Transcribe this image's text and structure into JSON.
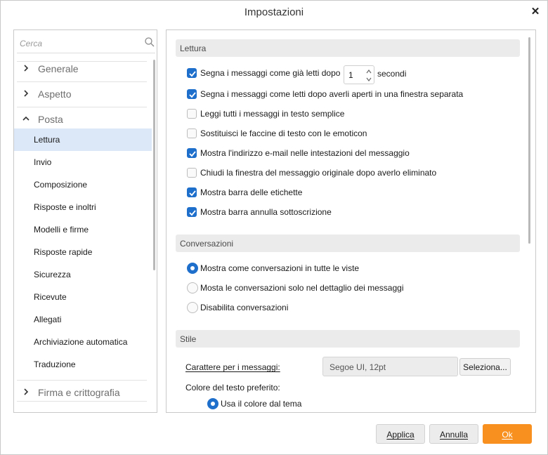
{
  "window": {
    "title": "Impostazioni"
  },
  "search": {
    "placeholder": "Cerca"
  },
  "nav": {
    "groups": [
      {
        "label": "Generale",
        "expanded": false
      },
      {
        "label": "Aspetto",
        "expanded": false
      },
      {
        "label": "Posta",
        "expanded": true
      },
      {
        "label": "Firma e crittografia",
        "expanded": false
      }
    ],
    "items": [
      {
        "label": "Lettura",
        "active": true
      },
      {
        "label": "Invio"
      },
      {
        "label": "Composizione"
      },
      {
        "label": "Risposte e inoltri"
      },
      {
        "label": "Modelli e firme"
      },
      {
        "label": "Risposte rapide"
      },
      {
        "label": "Sicurezza"
      },
      {
        "label": "Ricevute"
      },
      {
        "label": "Allegati"
      },
      {
        "label": "Archiviazione automatica"
      },
      {
        "label": "Traduzione"
      }
    ]
  },
  "lettura": {
    "header": "Lettura",
    "options": [
      {
        "label": "Segna i messaggi come già letti dopo",
        "checked": true
      },
      {
        "label": "Segna i messaggi come letti dopo averli aperti in una finestra separata",
        "checked": true
      },
      {
        "label": "Leggi tutti i messaggi in testo semplice",
        "checked": false
      },
      {
        "label": "Sostituisci le faccine di testo con le emoticon",
        "checked": false
      },
      {
        "label": "Mostra l'indirizzo e-mail nelle intestazioni del messaggio",
        "checked": true
      },
      {
        "label": "Chiudi la finestra del messaggio originale dopo averlo eliminato",
        "checked": false
      },
      {
        "label": "Mostra barra delle etichette",
        "checked": true
      },
      {
        "label": "Mostra barra annulla sottoscrizione",
        "checked": true
      }
    ],
    "delay_value": "1",
    "delay_unit": "secondi"
  },
  "conversazioni": {
    "header": "Conversazioni",
    "options": [
      {
        "label": "Mostra come conversazioni in tutte le viste",
        "selected": true
      },
      {
        "label": "Mosta le conversazioni solo nel dettaglio dei messaggi",
        "selected": false
      },
      {
        "label": "Disabilita conversazioni",
        "selected": false
      }
    ]
  },
  "stile": {
    "header": "Stile",
    "font_label": "Carattere per i messaggi:",
    "font_value": "Segoe UI, 12pt",
    "select_button": "Seleziona...",
    "color_label": "Colore del testo preferito:",
    "color_option": "Usa il colore dal tema",
    "color_option_selected": true
  },
  "buttons": {
    "apply": "Applica",
    "cancel": "Annulla",
    "ok": "Ok"
  },
  "colors": {
    "accent": "#1e6fcc",
    "primary_button": "#f7901e",
    "active_item": "#dce8f7"
  }
}
